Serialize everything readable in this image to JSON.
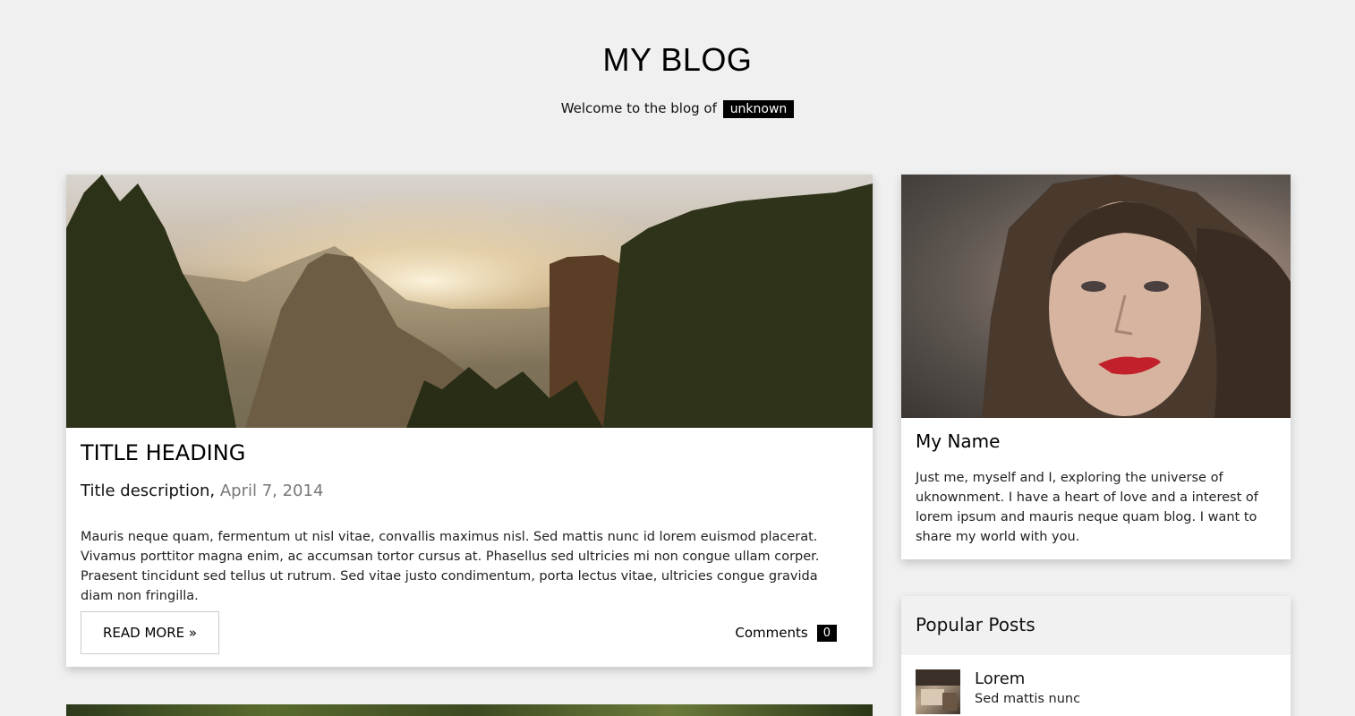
{
  "header": {
    "title": "MY BLOG",
    "welcome_text": "Welcome to the blog of",
    "user_tag": "unknown"
  },
  "post": {
    "title": "TITLE HEADING",
    "description": "Title description,",
    "date": "April 7, 2014",
    "body": "Mauris neque quam, fermentum ut nisl vitae, convallis maximus nisl. Sed mattis nunc id lorem euismod placerat. Vivamus porttitor magna enim, ac accumsan tortor cursus at. Phasellus sed ultricies mi non congue ullam corper. Praesent tincidunt sed tellus ut rutrum. Sed vitae justo condimentum, porta lectus vitae, ultricies congue gravida diam non fringilla.",
    "read_more_label": "READ MORE »",
    "comments_label": "Comments",
    "comments_count": "0"
  },
  "profile": {
    "name": "My Name",
    "bio": "Just me, myself and I, exploring the universe of uknownment. I have a heart of love and a interest of lorem ipsum and mauris neque quam blog. I want to share my world with you."
  },
  "popular": {
    "heading": "Popular Posts",
    "items": [
      {
        "title": "Lorem",
        "subtitle": "Sed mattis nunc"
      }
    ]
  }
}
